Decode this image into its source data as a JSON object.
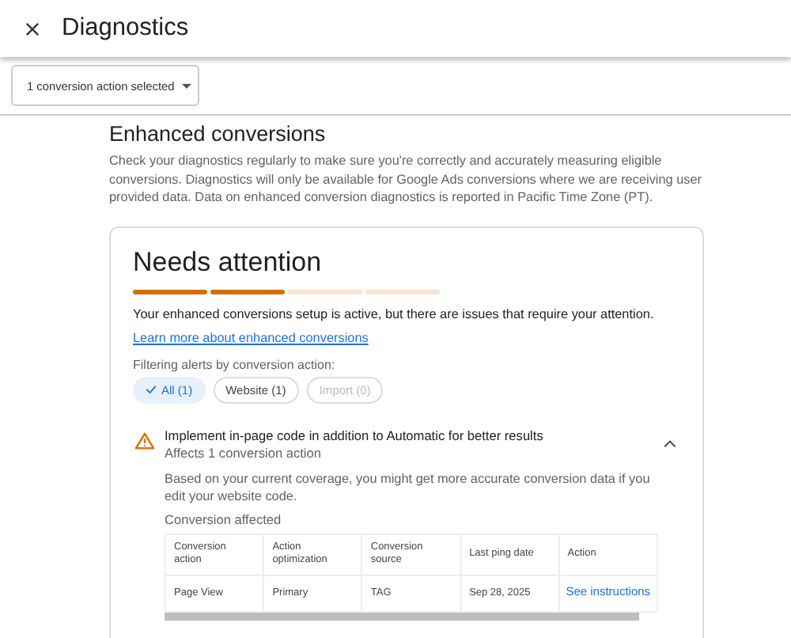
{
  "header": {
    "title": "Diagnostics"
  },
  "toolbar": {
    "dropdown": "1 conversion action selected"
  },
  "section": {
    "title": "Enhanced conversions",
    "description": "Check your diagnostics regularly to make sure you're correctly and accurately measuring eligible conversions. Diagnostics will only be available for Google Ads conversions where we are receiving user provided data. Data on enhanced conversion diagnostics is reported in Pacific Time Zone (PT)."
  },
  "card": {
    "title": "Needs attention",
    "progress": [
      {
        "filled": true
      },
      {
        "filled": true
      },
      {
        "filled": false
      },
      {
        "filled": false
      }
    ],
    "message": "Your enhanced conversions setup is active, but there are issues that require your attention.",
    "link": "Learn more about enhanced conversions",
    "filter_label": "Filtering alerts by conversion action:",
    "chips": [
      {
        "label": "All (1)",
        "selected": true,
        "disabled": false
      },
      {
        "label": "Website (1)",
        "selected": false,
        "disabled": false
      },
      {
        "label": "Import (0)",
        "selected": false,
        "disabled": true
      }
    ],
    "alert": {
      "title": "Implement in-page code in addition to Automatic for better results",
      "subtitle": "Affects 1 conversion action",
      "expanded": true,
      "body": "Based on your current coverage, you might get more accurate conversion data if you edit your website code.",
      "table_title": "Conversion affected",
      "table": {
        "columns": [
          "Conversion action",
          "Action optimization",
          "Conversion source",
          "Last ping date",
          "Action"
        ],
        "rows": [
          {
            "cells": [
              "Page View",
              "Primary",
              "TAG",
              "Sep 28, 2025"
            ],
            "action": "See instructions"
          }
        ]
      }
    }
  }
}
